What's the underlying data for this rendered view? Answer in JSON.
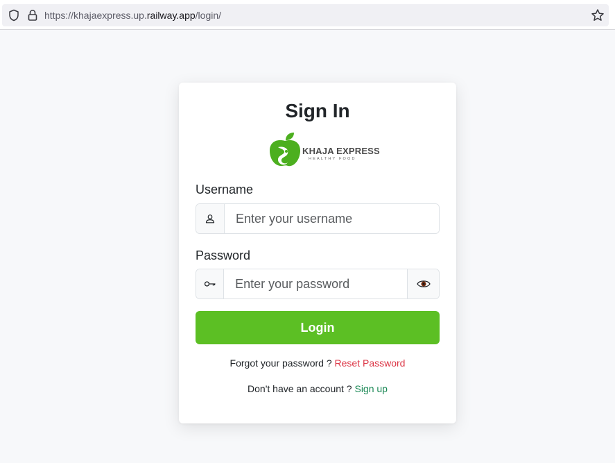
{
  "browser": {
    "url_prefix": "https://khajaexpress.up.",
    "url_domain": "railway.app",
    "url_suffix": "/login/",
    "icons": [
      "shield-icon",
      "lock-icon",
      "star-icon"
    ]
  },
  "login_card": {
    "title": "Sign In",
    "logo": {
      "brand_name": "KHAJA EXPRESS",
      "tagline": "HEALTHY FOOD",
      "colors": {
        "green": "#4caf1f",
        "text": "#4a4a4a"
      }
    },
    "username": {
      "label": "Username",
      "placeholder": "Enter your username",
      "value": "",
      "icon": "user-icon"
    },
    "password": {
      "label": "Password",
      "placeholder": "Enter your password",
      "value": "",
      "icon": "key-icon",
      "toggle_icon": "eye-icon"
    },
    "login_button": "Login",
    "forgot_text": "Forgot your password ?",
    "reset_link": "Reset Password",
    "signup_text": "Don't have an account ?",
    "signup_link": "Sign up"
  },
  "colors": {
    "primary_button": "#5cbf24",
    "reset_link": "#dc3545",
    "signup_link": "#198754",
    "page_background": "#f7f8fa"
  }
}
